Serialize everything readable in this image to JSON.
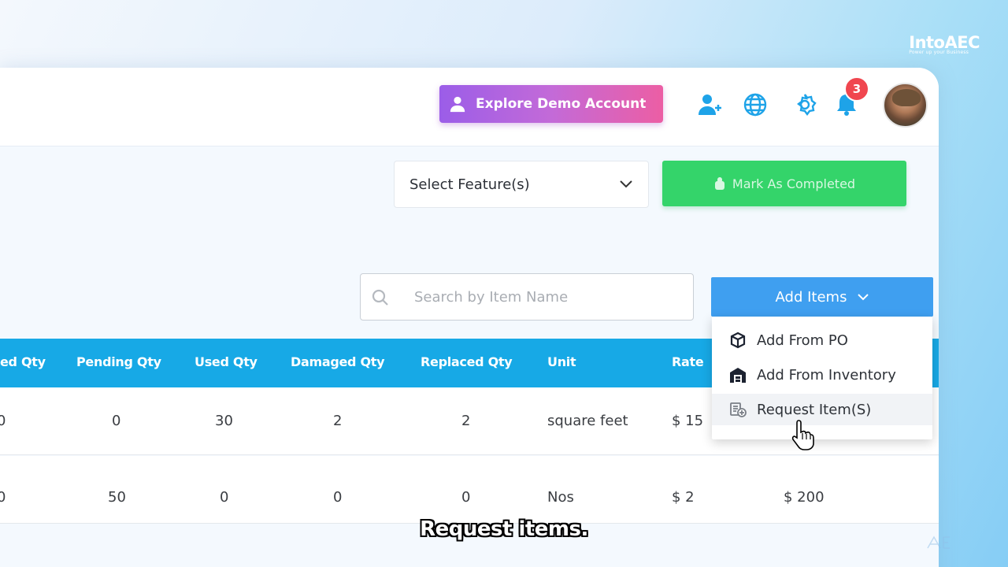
{
  "brand": {
    "name": "IntoAEC",
    "tagline": "Power up your Business"
  },
  "header": {
    "demo_button_label": "Explore Demo Account",
    "notification_count": "3",
    "icons": [
      "add-user-icon",
      "globe-icon",
      "gear-icon",
      "bell-icon"
    ]
  },
  "toolbar": {
    "select_feature_label": "Select Feature(s)",
    "mark_completed_label": "Mark As Completed"
  },
  "search": {
    "placeholder": "Search by Item Name",
    "value": ""
  },
  "add_items": {
    "label": "Add Items",
    "menu": [
      {
        "label": "Add From PO",
        "icon": "box-icon"
      },
      {
        "label": "Add From Inventory",
        "icon": "warehouse-icon"
      },
      {
        "label": "Request Item(S)",
        "icon": "request-icon"
      }
    ]
  },
  "table": {
    "columns": [
      "ed Qty",
      "Pending Qty",
      "Used Qty",
      "Damaged Qty",
      "Replaced Qty",
      "Unit",
      "Rate"
    ],
    "rows": [
      {
        "c0": "0",
        "pending": "0",
        "used": "30",
        "damaged": "2",
        "replaced": "2",
        "unit": "square feet",
        "rate": "$ 15",
        "amount": ""
      },
      {
        "c0": "0",
        "pending": "50",
        "used": "0",
        "damaged": "0",
        "replaced": "0",
        "unit": "Nos",
        "rate": "$ 2",
        "amount": "$ 200"
      }
    ]
  },
  "subtitle": "Request items.",
  "colors": {
    "table_header": "#17a9e6",
    "add_button": "#3f9ff0",
    "mark_button": "#34d46a",
    "demo_gradient": [
      "#9b5de8",
      "#ec5ea4"
    ],
    "badge": "#f0464f"
  }
}
